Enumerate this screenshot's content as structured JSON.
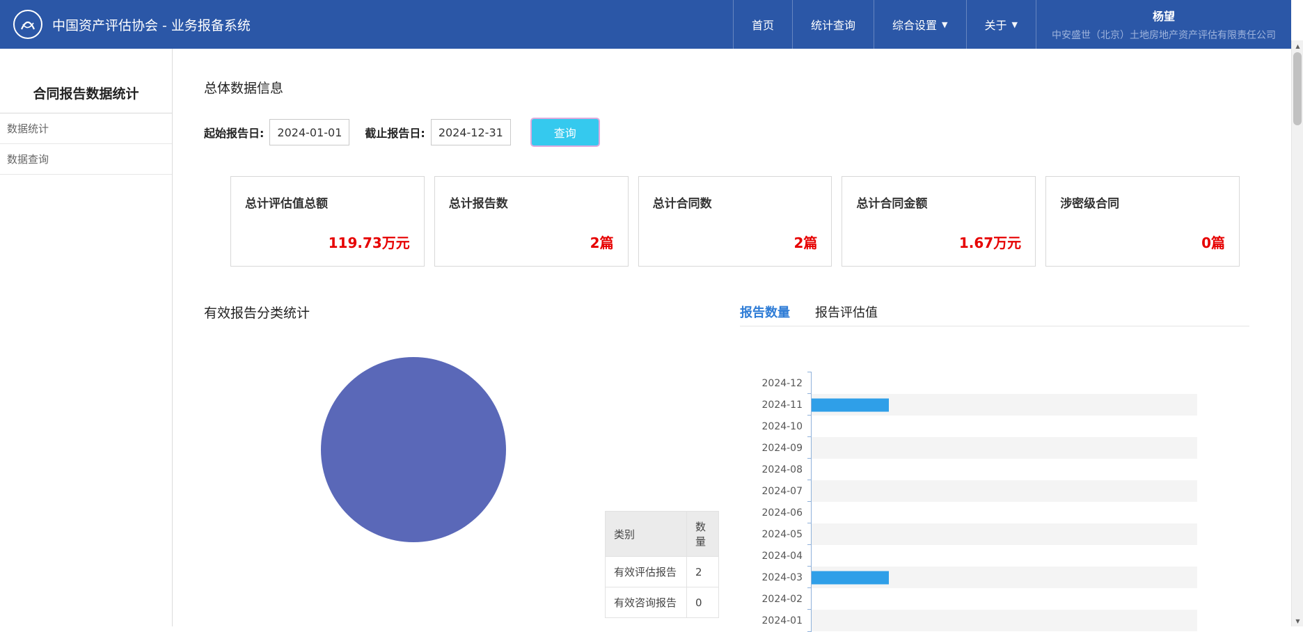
{
  "navbar": {
    "title": "中国资产评估协会 - 业务报备系统",
    "items": [
      {
        "label": "首页",
        "dropdown": false
      },
      {
        "label": "统计查询",
        "dropdown": false
      },
      {
        "label": "综合设置",
        "dropdown": true
      },
      {
        "label": "关于",
        "dropdown": true
      }
    ],
    "user_name": "杨望",
    "user_company": "中安盛世（北京）土地房地产资产评估有限责任公司"
  },
  "sidebar": {
    "title": "合同报告数据统计",
    "items": [
      {
        "label": "数据统计"
      },
      {
        "label": "数据查询"
      }
    ]
  },
  "main": {
    "section_title": "总体数据信息"
  },
  "filters": {
    "start_label": "起始报告日:",
    "start_value": "2024-01-01",
    "end_label": "截止报告日:",
    "end_value": "2024-12-31",
    "query_button": "查询"
  },
  "cards": [
    {
      "label": "总计评估值总额",
      "value": "119.73万元"
    },
    {
      "label": "总计报告数",
      "value": "2篇"
    },
    {
      "label": "总计合同数",
      "value": "2篇"
    },
    {
      "label": "总计合同金额",
      "value": "1.67万元"
    },
    {
      "label": "涉密级合同",
      "value": "0篇"
    }
  ],
  "pie_section": {
    "title": "有效报告分类统计",
    "table": {
      "headers": [
        "类别",
        "数量"
      ],
      "rows": [
        [
          "有效评估报告",
          "2"
        ],
        [
          "有效咨询报告",
          "0"
        ]
      ]
    }
  },
  "bar_section": {
    "tabs": [
      {
        "label": "报告数量",
        "active": true
      },
      {
        "label": "报告评估值",
        "active": false
      }
    ]
  },
  "chart_data": [
    {
      "type": "pie",
      "title": "有效报告分类统计",
      "labels": [
        "有效评估报告",
        "有效咨询报告"
      ],
      "values": [
        2,
        0
      ],
      "colors": [
        "#5a68b8",
        "#5a68b8"
      ],
      "legend_position": "none"
    },
    {
      "type": "bar",
      "orientation": "horizontal",
      "title": "报告数量",
      "categories": [
        "2024-12",
        "2024-11",
        "2024-10",
        "2024-09",
        "2024-08",
        "2024-07",
        "2024-06",
        "2024-05",
        "2024-04",
        "2024-03",
        "2024-02",
        "2024-01"
      ],
      "values": [
        0,
        1,
        0,
        0,
        0,
        0,
        0,
        0,
        0,
        1,
        0,
        0
      ],
      "xlim": [
        0,
        5
      ],
      "grid": false,
      "bar_color": "#2f9fe8"
    }
  ],
  "colors": {
    "navbar_bg": "#2b57a7",
    "accent_red": "#e60000",
    "pie_color": "#5a68b8",
    "bar_color": "#2f9fe8",
    "tab_active": "#2e7cd6",
    "button_bg": "#35c9ee",
    "button_border": "#dcaade"
  }
}
